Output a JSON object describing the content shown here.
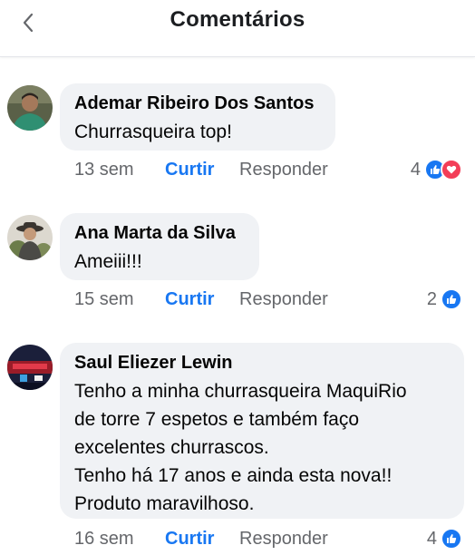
{
  "header": {
    "title": "Comentários"
  },
  "actions": {
    "like_label": "Curtir",
    "reply_label": "Responder"
  },
  "colors": {
    "accent": "#1877f2",
    "love": "#f33e58",
    "bubble": "#f0f2f5",
    "meta_text": "#65676b"
  },
  "comments": [
    {
      "author": "Ademar Ribeiro Dos Santos",
      "text": "Churrasqueira top!",
      "time": "13 sem",
      "reaction_count": "4",
      "reactions": [
        "like-icon",
        "love-icon"
      ]
    },
    {
      "author": "Ana Marta da Silva",
      "text": "Ameiii!!!",
      "time": "15 sem",
      "reaction_count": "2",
      "reactions": [
        "like-icon"
      ]
    },
    {
      "author": "Saul Eliezer Lewin",
      "text": "Tenho a minha churrasqueira MaquiRio\nde torre 7 espetos e também faço\nexcelentes  churrascos.\nTenho há 17 anos e ainda esta nova!!\nProduto maravilhoso.",
      "time": "16 sem",
      "reaction_count": "4",
      "reactions": [
        "like-icon"
      ]
    }
  ]
}
